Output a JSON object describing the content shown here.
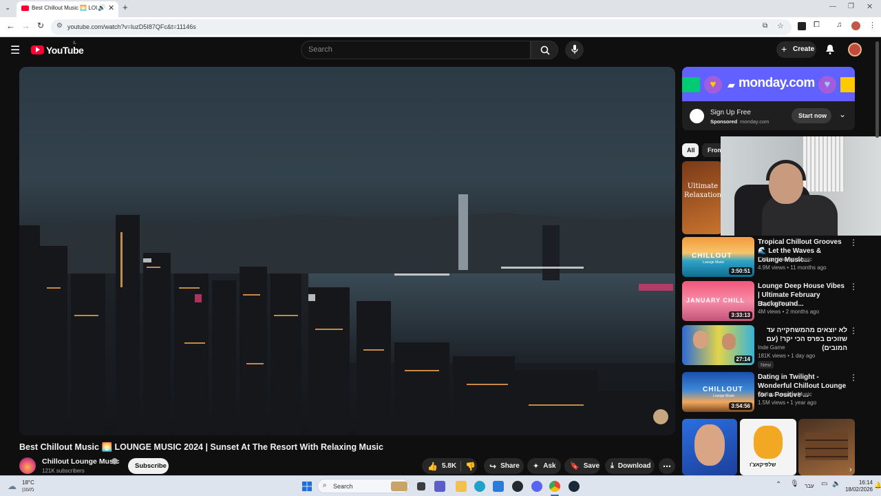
{
  "browser": {
    "tab_title": "Best Chillout Music 🌅 LOU",
    "url": "youtube.com/watch?v=luzD5I87QFc&t=11146s"
  },
  "masthead": {
    "logo": "YouTube",
    "logo_region": "IL",
    "search_placeholder": "Search",
    "create_label": "Create"
  },
  "video": {
    "title": "Best Chillout Music 🌅 LOUNGE MUSIC 2024 | Sunset At The Resort With Relaxing Music",
    "channel_name": "Chillout Lounge Music",
    "subscribers": "121K subscribers",
    "subscribe_label": "Subscribe",
    "likes": "5.8K",
    "share_label": "Share",
    "ask_label": "Ask",
    "save_label": "Save",
    "download_label": "Download"
  },
  "ad": {
    "brand": "monday.com",
    "title": "Sign Up Free",
    "sponsored": "Sponsored",
    "domain": "monday.com",
    "cta": "Start now"
  },
  "chips": [
    "All",
    "From"
  ],
  "recommendations": [
    {
      "thumb_text": "Ultimate Relaxation"
    },
    {
      "title": "Tropical Chillout Grooves 🌊 Let the Waves & Lounge Music...",
      "channel": "Chillout Lounge Music",
      "meta": "4.9M views • 11 months ago",
      "duration": "3:50:51",
      "thumb_text": "CHILLOUT",
      "thumb_sub": "Lounge Music"
    },
    {
      "title": "Lounge Deep House Vibes | Ultimate February Background...",
      "channel": "Rhythm Depths",
      "meta": "4M views • 2 months ago",
      "duration": "3:33:13",
      "thumb_text": "JANUARY CHILL"
    },
    {
      "title": "לא יוצאים מהמשחקייה עד שזוכים בפרס הכי יקר! (עם המובים)",
      "channel": "Inde Game",
      "meta": "181K views • 1 day ago",
      "badge": "New",
      "duration": "27:14"
    },
    {
      "title": "Dating in Twilight - Wonderful Chillout Lounge for a Positive ...",
      "channel": "Chillout Lounge Music",
      "meta": "1.5M views • 1 year ago",
      "duration": "3:54:56",
      "thumb_text": "CHILLOUT",
      "thumb_sub": "Lounge Music"
    }
  ],
  "shorts_caption": "שלפיקאצ'ו",
  "taskbar": {
    "weather_temp": "18°C",
    "weather_desc": "מעונן",
    "search_label": "Search",
    "lang": "עבר",
    "time": "16:14",
    "date": "18/02/2026"
  },
  "colors": {
    "yt_red": "#ff0033",
    "monday_purple": "#6161ff",
    "bg": "#0f0f0f"
  }
}
